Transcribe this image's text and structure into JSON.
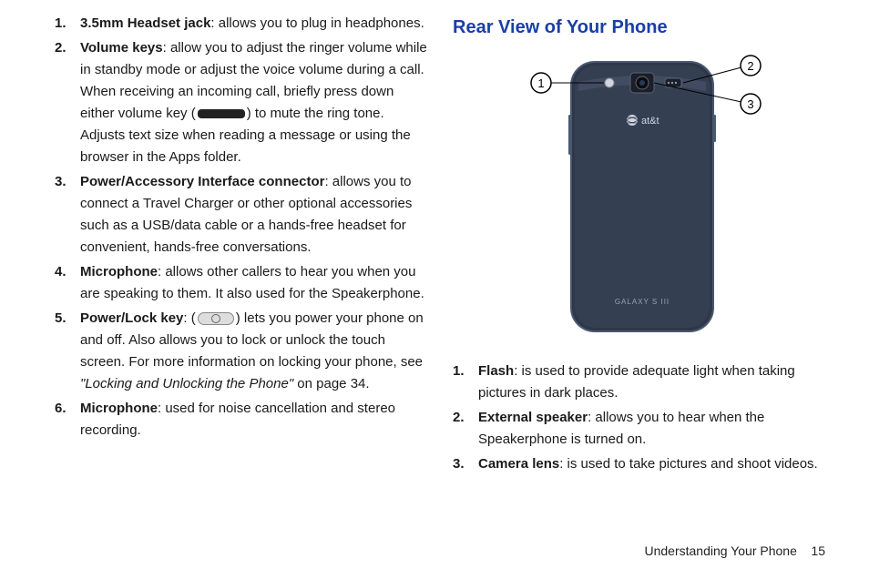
{
  "left": {
    "items": [
      {
        "term": "3.5mm Headset jack",
        "desc": ": allows you to plug in headphones."
      },
      {
        "term": "Volume keys",
        "desc_a": ": allow you to adjust the ringer volume while in standby mode or adjust the voice volume during a call. When receiving an incoming call, briefly press down either volume key (",
        "desc_b": ") to mute the ring tone. Adjusts text size when reading a message or using the browser in the Apps folder."
      },
      {
        "term": "Power/Accessory Interface connector",
        "desc": ": allows you to connect a Travel Charger or other optional accessories such as a USB/data cable or a hands-free headset for convenient, hands-free conversations."
      },
      {
        "term": "Microphone",
        "desc": ": allows other callers to hear you when you are speaking to them. It also used for the Speakerphone."
      },
      {
        "term": "Power/Lock key",
        "desc_a": ": (",
        "desc_b": ") lets you power your phone on and off. Also allows you to lock or unlock the touch screen. For more information on locking your phone, see ",
        "ref": "\"Locking and Unlocking the Phone\"",
        "desc_c": " on page 34."
      },
      {
        "term": "Microphone",
        "desc": ": used for noise cancellation and stereo recording."
      }
    ]
  },
  "right": {
    "heading": "Rear View of Your Phone",
    "phone_label_top": "at&t",
    "phone_label_bottom": "GALAXY S III",
    "callouts": {
      "1": "1",
      "2": "2",
      "3": "3"
    },
    "items": [
      {
        "term": "Flash",
        "desc": ": is used to provide adequate light when taking pictures in dark places."
      },
      {
        "term": "External speaker",
        "desc": ": allows you to hear when the Speakerphone is turned on."
      },
      {
        "term": "Camera lens",
        "desc": ": is used to take pictures and shoot videos."
      }
    ]
  },
  "footer": {
    "section": "Understanding Your Phone",
    "page": "15"
  }
}
